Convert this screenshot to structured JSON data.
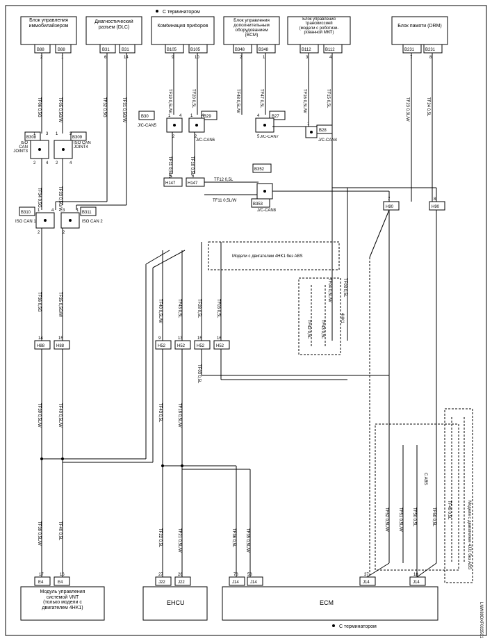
{
  "doc_id": "LNW89DXF003501",
  "terminator_top": "С терминатором",
  "terminator_bottom": "С терминатором",
  "blocks": {
    "b1": "Блок управления\nиммобилайзером",
    "b2": "Диагностический\nразъем (DLC)",
    "b3": "Комбинация приборов",
    "b4": "Блок управления\nдополнительным\nоборудованием\n(BCM)",
    "b5": "Блок управления\nтрансмиссией\n(модели с роботизи-\nрованной МКП)",
    "b6": "Блок памяти (DRM)",
    "vnt": "Модуль управления\nсистемой VNT\n(только модели с\nдвигателем 4HK1)",
    "ehcu": "EHCU",
    "ecm": "ECM"
  },
  "notes": {
    "note1": "Модели с двигателем 4HK1 без ABS",
    "note2": "Модели с двигателем 4JJ1 без ABS",
    "cabs": "C ABS",
    "k4hk1": "4HK1"
  },
  "jc": {
    "can5": "J/C-CAN5",
    "can6": "J/C-CAN6",
    "can7": "J/C-CAN7",
    "can8": "J/C-CAN8",
    "can4": "J/C-CAN4",
    "joint3": "ISO CAN\nJOINT3",
    "joint4": "ISO CAN\nJOINT4",
    "isocan1": "ISO CAN 1",
    "isocan2": "ISO CAN 2"
  },
  "connectors": {
    "B88a": "B88",
    "B88b": "B88",
    "B31a": "B31",
    "B31b": "B31",
    "B105a": "B105",
    "B105b": "B105",
    "B348a": "B348",
    "B348b": "B348",
    "B112a": "B112",
    "B112b": "B112",
    "B231a": "B231",
    "B231b": "B231",
    "B308": "B308",
    "B309": "B309",
    "B310": "B310",
    "B311": "B311",
    "B30": "B30",
    "B29": "B29",
    "B27": "B27",
    "B28": "B28",
    "B352": "B352",
    "B353": "B353",
    "H147a": "H147",
    "H147b": "H147",
    "H88a": "H88",
    "H88b": "H88",
    "H52a": "H52",
    "H52b": "H52",
    "H52c": "H52",
    "H52d": "H52",
    "H90a": "H90",
    "H90b": "H90",
    "E4a": "E4",
    "E4b": "E4",
    "J22a": "J22",
    "J22b": "J22",
    "J14a": "J14",
    "J14b": "J14",
    "J14c": "J14",
    "J14d": "J14"
  },
  "wires": {
    "TF06_05G": "TF06 0,5G",
    "TF05_05GW": "TF05 0,5G/W",
    "TF32_05G": "TF32 0,5G",
    "TF31_05GW": "TF31 0,5G/W",
    "TF34_05G": "TF34 0,5G",
    "TF33_05GW": "TF33 0,5G/W",
    "TF36_05G": "TF36 0,5G",
    "TF35_05GW": "TF35 0,5G/W",
    "TF19_05LW": "TF19\n0,5L/W",
    "TF20_05L": "TF20\n0,5L",
    "TF48_05LW": "TF48\n0,5L/W",
    "TF47_05L": "TF47\n0,5L",
    "TF16_05LW": "TF16\n0,5L/W",
    "TF15_05L": "TF15\n0,5L",
    "TF23_03LW": "TF23\n0,3L/W",
    "TF24_05L": "TF24\n0,5L",
    "TF11_05LW": "TF11\n0,5L/W",
    "TF10_05L": "TF10\n0,5L",
    "TF12_05L": "TF12 0,5L",
    "TF11_05LW_h": "TF11 0,5L/W",
    "TF04_05LW": "TF04 0,5L/W",
    "TF03_05L": "TF03 0,5L",
    "TF40_05LW": "TF40 0,5L/W",
    "TF43_05L": "TF43 0,5L",
    "TF28_05L": "TF28 0,5L",
    "TF42_05L": "TF42 0,5L",
    "TF43_05L2": "TF43 0,5L",
    "TF39_05LW": "TF39 0,5L/W",
    "TF40_05LW2": "TF40 0,5L/W",
    "TF22_05L": "TF22 0,5L",
    "TF21_05LW": "TF21 0,5L/W",
    "TF36_05L": "TF36 0,5L",
    "TF35_05LW": "TF35 0,5L/W",
    "TF52_05LW": "TF52 0,5L/W",
    "TF51_05LW": "TF51 0,5L/W",
    "TF50_05L": "TF50 0,5L",
    "TF49_05L": "TF49 0,5L",
    "TF43b_05L": "TF43 0,5L",
    "TF18_05LW": "TF18 0,5L/W",
    "TF03b_05L": "TF03 0,5L"
  }
}
